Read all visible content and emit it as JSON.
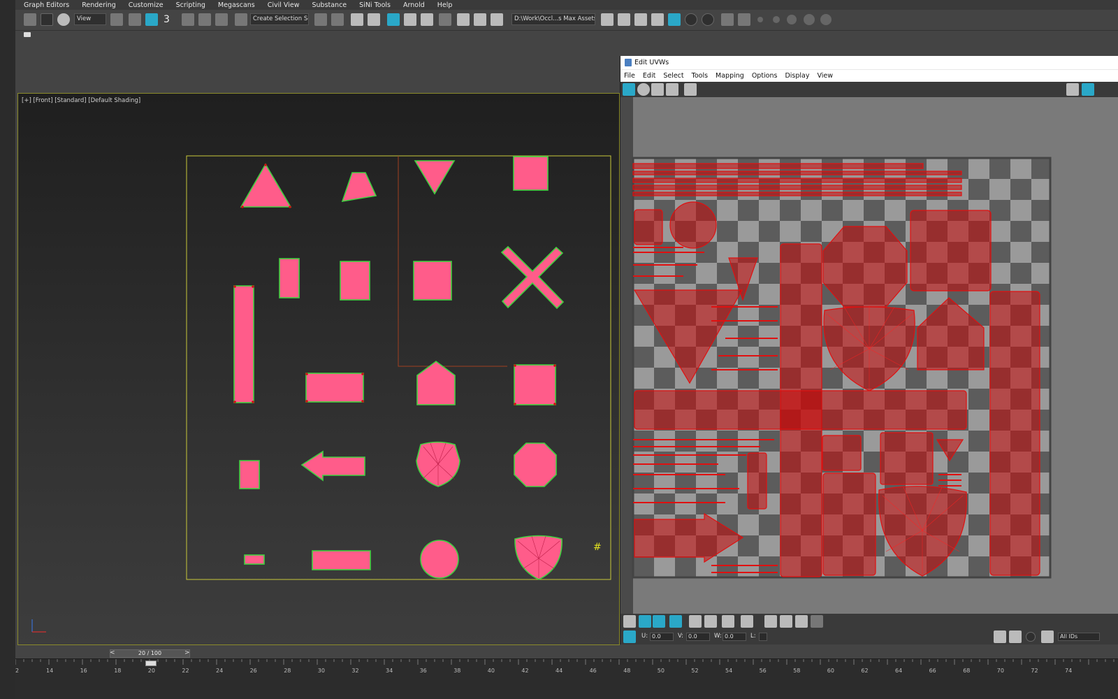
{
  "menubar": {
    "items": [
      "Graph Editors",
      "Rendering",
      "Customize",
      "Scripting",
      "Megascans",
      "Civil View",
      "Substance",
      "SiNi Tools",
      "Arnold",
      "Help"
    ]
  },
  "toolbar": {
    "view_dropdown": "View",
    "selection_set_dropdown": "Create Selection Se",
    "snap_label": "3",
    "path_dropdown": "D:\\Work\\Occl...s Max Assets"
  },
  "viewport": {
    "label": "[+] [Front] [Standard] [Default Shading]"
  },
  "uv_editor": {
    "title": "Edit UVWs",
    "menu": [
      "File",
      "Edit",
      "Select",
      "Tools",
      "Mapping",
      "Options",
      "Display",
      "View"
    ],
    "u_label": "U:",
    "u_value": "0.0",
    "v_label": "V:",
    "v_value": "0.0",
    "w_label": "W:",
    "w_value": "0.0",
    "l_label": "L:",
    "ids_dropdown": "All IDs"
  },
  "timeline": {
    "frame_counter": "20 / 100",
    "prev_label": "<",
    "next_label": ">",
    "ticks": [
      "2",
      "14",
      "16",
      "18",
      "20",
      "22",
      "24",
      "26",
      "28",
      "30",
      "32",
      "34",
      "36",
      "38",
      "40",
      "42",
      "44",
      "46",
      "48",
      "50",
      "52",
      "54",
      "56",
      "58",
      "60",
      "62",
      "64",
      "66",
      "68",
      "70",
      "72",
      "74"
    ],
    "current_frame": "20"
  },
  "colors": {
    "shape_fill": "#ff5c8a",
    "shape_edge": "#40d040",
    "uv_red": "#e01010",
    "selection_yellow": "#c8c83a"
  }
}
